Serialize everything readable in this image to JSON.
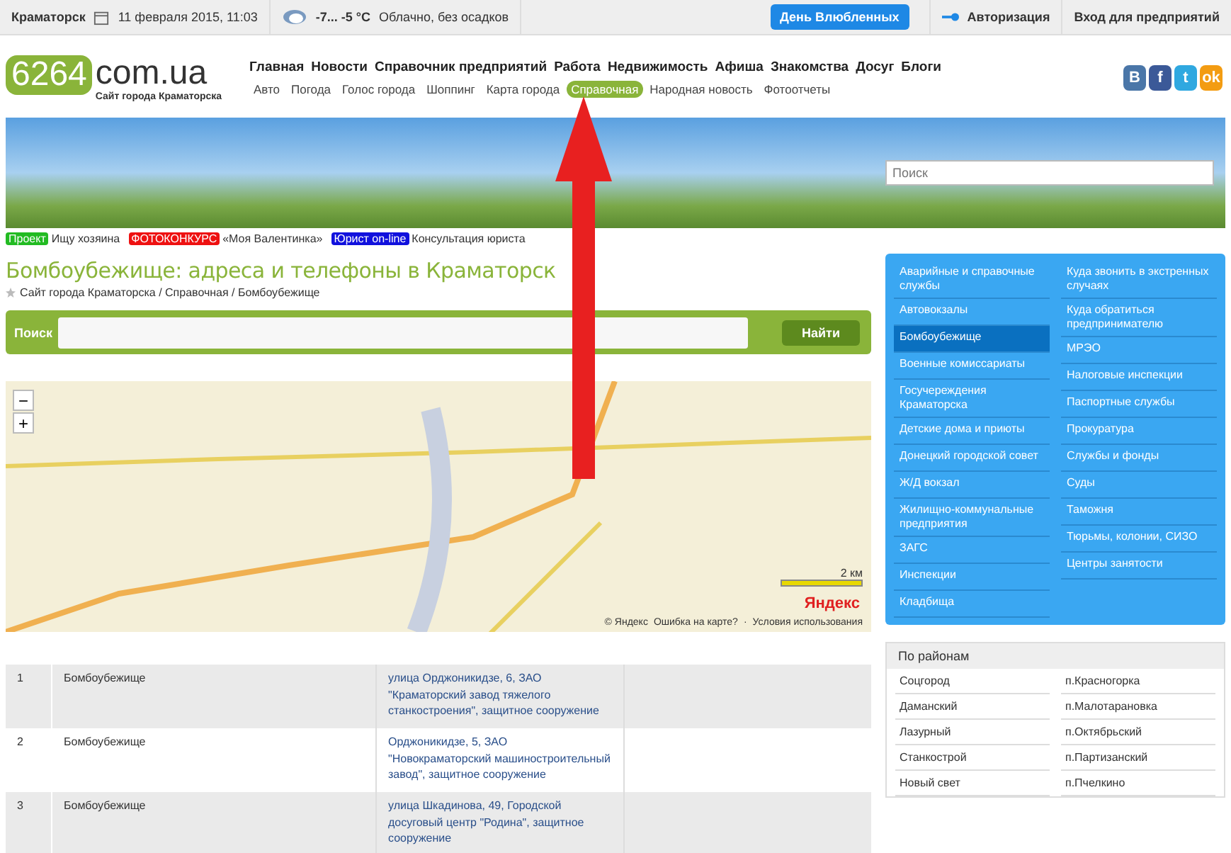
{
  "top_bar": {
    "city": "Краматорск",
    "date": "11 февраля 2015, 11:03",
    "temperature": "-7... -5 °C",
    "weather": "Облачно, без осадков",
    "promo_badge": "День Влюбленных",
    "login": "Авторизация",
    "business_login": "Вход для предприятий"
  },
  "logo": {
    "number": "6264",
    "domain": "com.ua",
    "tagline": "Сайт города Краматорска"
  },
  "main_nav": [
    {
      "label": "Главная"
    },
    {
      "label": "Новости"
    },
    {
      "label": "Справочник предприятий"
    },
    {
      "label": "Работа"
    },
    {
      "label": "Недвижимость"
    },
    {
      "label": "Афиша"
    },
    {
      "label": "Знакомства"
    },
    {
      "label": "Досуг"
    },
    {
      "label": "Блоги"
    }
  ],
  "sub_nav": [
    {
      "label": "Авто",
      "selected": false
    },
    {
      "label": "Погода",
      "selected": false
    },
    {
      "label": "Голос города",
      "selected": false
    },
    {
      "label": "Шоппинг",
      "selected": false
    },
    {
      "label": "Карта города",
      "selected": false
    },
    {
      "label": "Справочная",
      "selected": true
    },
    {
      "label": "Народная новость",
      "selected": false
    },
    {
      "label": "Фотоотчеты",
      "selected": false
    }
  ],
  "social": [
    {
      "label": "B",
      "color": "#4a76a8"
    },
    {
      "label": "f",
      "color": "#3b5998"
    },
    {
      "label": "t",
      "color": "#2fa8e0"
    },
    {
      "label": "ok",
      "color": "#f39c12"
    }
  ],
  "banner": {
    "search_placeholder": "Поиск"
  },
  "promos": [
    {
      "tag": "Проект",
      "color": "#22bb22",
      "text": "Ищу хозяина"
    },
    {
      "tag": "ФОТОКОНКУРС",
      "color": "#ee1111",
      "text": "«Моя Валентинка»"
    },
    {
      "tag": "Юрист on-line",
      "color": "#1111dd",
      "text": "Консультация юриста"
    }
  ],
  "heading": "Бомбоубежище: адреса и телефоны в Краматорск",
  "breadcrumb": "Сайт города Краматорска / Справочная / Бомбоубежище",
  "search": {
    "label": "Поиск",
    "button": "Найти"
  },
  "map": {
    "zoom_out": "−",
    "zoom_in": "+",
    "scale": "2 км",
    "logo": "Яндекс",
    "copyright": "© Яндекс",
    "error_link": "Ошибка на карте?",
    "separator": "·",
    "terms_link": "Условия использования"
  },
  "table": {
    "rows": [
      {
        "number": "1",
        "name": "Бомбоубежище",
        "address": "улица Орджоникидзе, 6, ЗАО \"Краматорский завод тяжелого станкостроения\", защитное сооружение"
      },
      {
        "number": "2",
        "name": "Бомбоубежище",
        "address": "Орджоникидзе, 5, ЗАО \"Новокраматорский машиностроительный завод\", защитное сооружение"
      },
      {
        "number": "3",
        "name": "Бомбоубежище",
        "address": "улица Шкадинова, 49, Городской досуговый центр \"Родина\", защитное сооружение"
      }
    ]
  },
  "categories": {
    "column_1": [
      {
        "label": "Аварийные и справочные службы",
        "selected": false
      },
      {
        "label": "Автовокзалы",
        "selected": false
      },
      {
        "label": "Бомбоубежище",
        "selected": true
      },
      {
        "label": "Военные комиссариаты",
        "selected": false
      },
      {
        "label": "Госучереждения Краматорска",
        "selected": false
      },
      {
        "label": "Детские дома и приюты",
        "selected": false
      },
      {
        "label": "Донецкий городской совет",
        "selected": false
      },
      {
        "label": "Ж/Д вокзал",
        "selected": false
      },
      {
        "label": "Жилищно-коммунальные предприятия",
        "selected": false
      },
      {
        "label": "ЗАГС",
        "selected": false
      },
      {
        "label": "Инспекции",
        "selected": false
      },
      {
        "label": "Кладбища",
        "selected": false
      }
    ],
    "column_2": [
      {
        "label": "Куда звонить в экстренных случаях",
        "selected": false
      },
      {
        "label": "Куда обратиться предпринимателю",
        "selected": false
      },
      {
        "label": "МРЭО",
        "selected": false
      },
      {
        "label": "Налоговые инспекции",
        "selected": false
      },
      {
        "label": "Паспортные службы",
        "selected": false
      },
      {
        "label": "Прокуратура",
        "selected": false
      },
      {
        "label": "Службы и фонды",
        "selected": false
      },
      {
        "label": "Суды",
        "selected": false
      },
      {
        "label": "Таможня",
        "selected": false
      },
      {
        "label": "Тюрьмы, колонии, СИЗО",
        "selected": false
      },
      {
        "label": "Центры занятости",
        "selected": false
      }
    ]
  },
  "districts": {
    "title": "По районам",
    "column_1": [
      "Соцгород",
      "Даманский",
      "Лазурный",
      "Станкострой",
      "Новый свет"
    ],
    "column_2": [
      "п.Красногорка",
      "п.Малотарановка",
      "п.Октябрьский",
      "п.Партизанский",
      "п.Пчелкино"
    ]
  }
}
